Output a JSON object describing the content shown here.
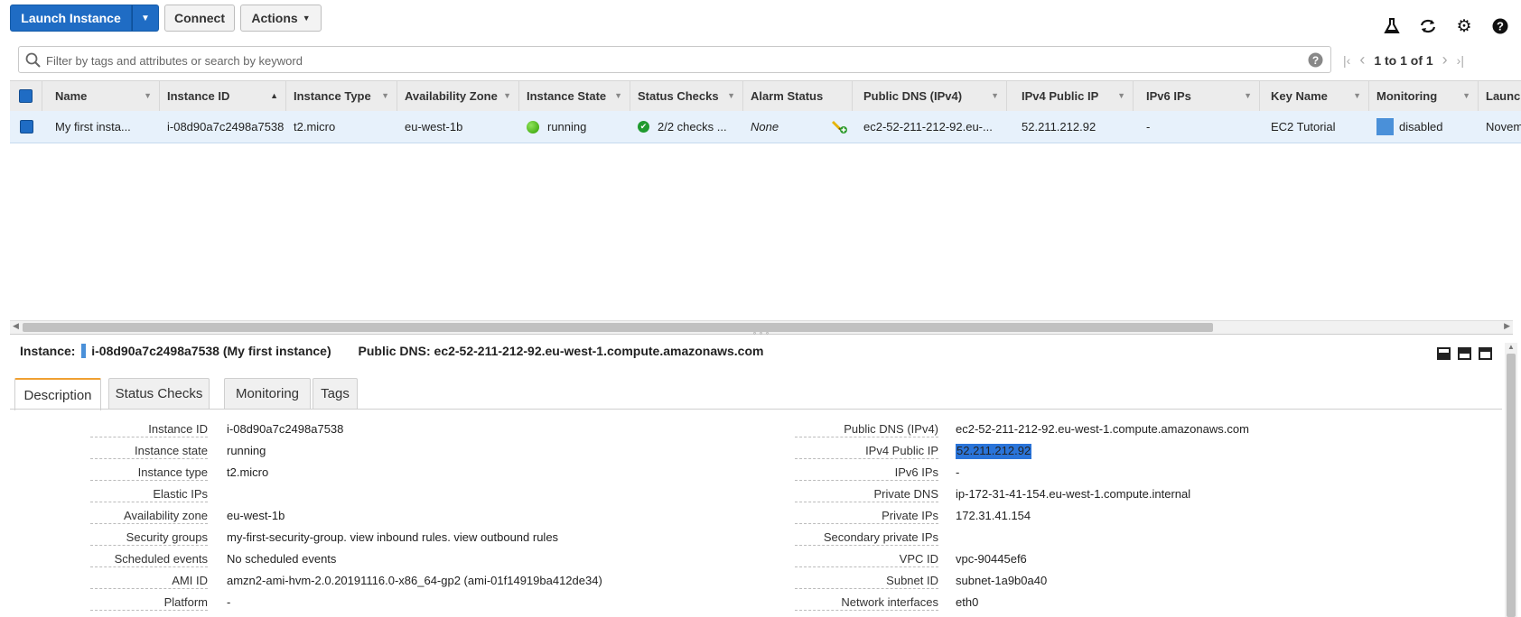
{
  "toolbar": {
    "launch_label": "Launch Instance",
    "connect_label": "Connect",
    "actions_label": "Actions"
  },
  "search": {
    "placeholder": "Filter by tags and attributes or search by keyword"
  },
  "pager": {
    "text": "1 to 1 of 1"
  },
  "columns": [
    "Name",
    "Instance ID",
    "Instance Type",
    "Availability Zone",
    "Instance State",
    "Status Checks",
    "Alarm Status",
    "Public DNS (IPv4)",
    "IPv4 Public IP",
    "IPv6 IPs",
    "Key Name",
    "Monitoring",
    "Launch"
  ],
  "row": {
    "name": "My first insta...",
    "instance_id": "i-08d90a7c2498a7538",
    "instance_type": "t2.micro",
    "zone": "eu-west-1b",
    "state": "running",
    "status_checks": "2/2 checks ...",
    "alarm_status": "None",
    "public_dns": "ec2-52-211-212-92.eu-...",
    "ipv4": "52.211.212.92",
    "ipv6": "-",
    "key_name": "EC2 Tutorial",
    "monitoring": "disabled",
    "launch": "Novem"
  },
  "detail": {
    "instance_label": "Instance:",
    "instance_value": "i-08d90a7c2498a7538 (My first instance)",
    "dns_label": "Public DNS:",
    "dns_value": "ec2-52-211-212-92.eu-west-1.compute.amazonaws.com"
  },
  "tabs": [
    "Description",
    "Status Checks",
    "Monitoring",
    "Tags"
  ],
  "left_fields": [
    {
      "key": "Instance ID",
      "value": "i-08d90a7c2498a7538"
    },
    {
      "key": "Instance state",
      "value": "running"
    },
    {
      "key": "Instance type",
      "value": "t2.micro"
    },
    {
      "key": "Elastic IPs",
      "value": ""
    },
    {
      "key": "Availability zone",
      "value": "eu-west-1b"
    },
    {
      "key": "Security groups",
      "value": "my-first-security-group. view inbound rules. view outbound rules"
    },
    {
      "key": "Scheduled events",
      "value": "No scheduled events"
    },
    {
      "key": "AMI ID",
      "value": "amzn2-ami-hvm-2.0.20191116.0-x86_64-gp2 (ami-01f14919ba412de34)"
    },
    {
      "key": "Platform",
      "value": "-"
    }
  ],
  "right_fields": [
    {
      "key": "Public DNS (IPv4)",
      "value": "ec2-52-211-212-92.eu-west-1.compute.amazonaws.com"
    },
    {
      "key": "IPv4 Public IP",
      "value": "52.211.212.92"
    },
    {
      "key": "IPv6 IPs",
      "value": "-"
    },
    {
      "key": "Private DNS",
      "value": "ip-172-31-41-154.eu-west-1.compute.internal"
    },
    {
      "key": "Private IPs",
      "value": "172.31.41.154"
    },
    {
      "key": "Secondary private IPs",
      "value": ""
    },
    {
      "key": "VPC ID",
      "value": "vpc-90445ef6"
    },
    {
      "key": "Subnet ID",
      "value": "subnet-1a9b0a40"
    },
    {
      "key": "Network interfaces",
      "value": "eth0"
    }
  ],
  "colors": {
    "primary": "#1f6cc4",
    "link": "#1a66c0",
    "row_selected": "#e7f1fb",
    "running": "#3bb300",
    "tab_accent": "#f0a032"
  },
  "icons": [
    "beaker-icon",
    "refresh-icon",
    "gear-icon",
    "help-icon",
    "search-icon",
    "help-circle-icon",
    "first-page-icon",
    "prev-page-icon",
    "next-page-icon",
    "last-page-icon",
    "alarm-add-icon"
  ]
}
